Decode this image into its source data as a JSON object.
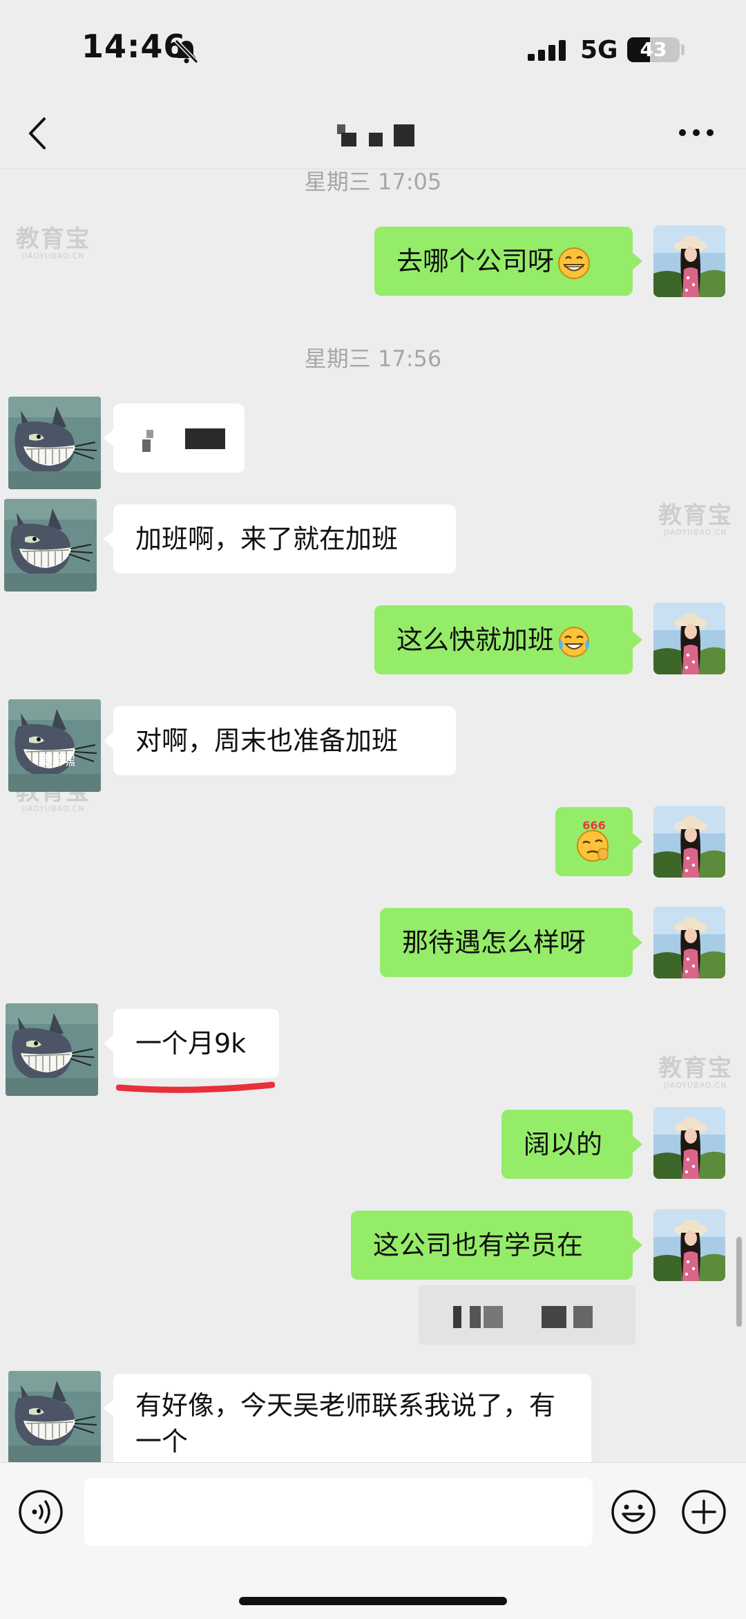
{
  "status_bar": {
    "time": "14:46",
    "network": "5G",
    "battery": "43",
    "battery_level": 0.43
  },
  "nav": {
    "more_icon": "more-icon",
    "back_icon": "back-icon"
  },
  "messages": {
    "time1": "星期三 17:05",
    "m1_out": "去哪个公司呀",
    "time2": "星期三 17:56",
    "m3_in": "加班啊，来了就在加班",
    "m4_out": "这么快就加班",
    "m5_in": "对啊，周末也准备加班",
    "m6_sticker": "666",
    "m7_out": "那待遇怎么样呀",
    "m8_in": "一个月9k",
    "m9_out": "阔以的",
    "m10_out": "这公司也有学员在",
    "m11_in": "有好像，今天吴老师联系我说了，有一个"
  },
  "avatar_caption": "嘿嘿嘿",
  "watermark": {
    "brand": "教育宝",
    "domain": "JIAOYUBAO.CN"
  },
  "input_bar": {
    "placeholder": ""
  },
  "colors": {
    "background": "#ededed",
    "bubble_out": "#95ec69",
    "bubble_in": "#ffffff",
    "underline": "#e8303a"
  }
}
